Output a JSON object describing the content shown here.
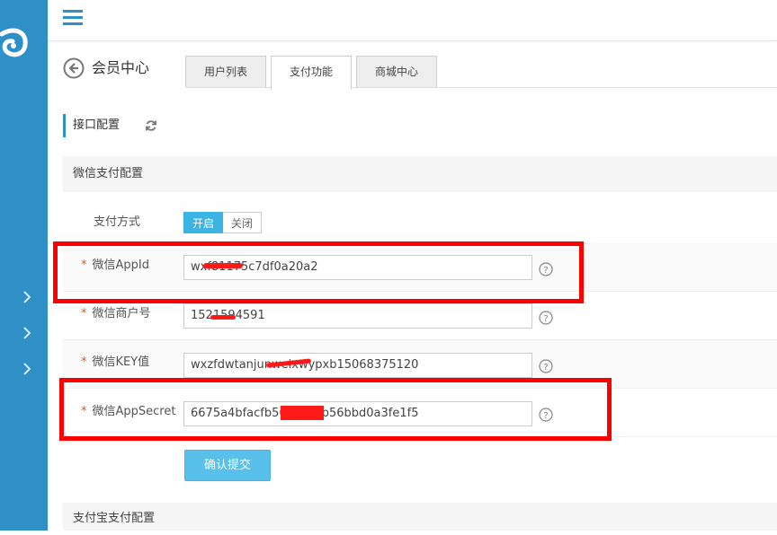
{
  "topbar": {
    "menu_icon": "hamburger-menu-icon"
  },
  "sidebar": {
    "logo_icon": "app-logo-icon",
    "arrows": [
      "chevron-right-icon",
      "chevron-right-icon",
      "chevron-right-icon"
    ]
  },
  "page": {
    "title": "会员中心",
    "back_icon": "back-arrow-circle-icon"
  },
  "tabs": [
    {
      "label": "用户列表",
      "active": false
    },
    {
      "label": "支付功能",
      "active": true
    },
    {
      "label": "商城中心",
      "active": false
    }
  ],
  "section": {
    "title": "接口配置",
    "refresh_icon": "refresh-icon"
  },
  "wechat": {
    "group_title": "微信支付配置",
    "pay_mode_label": "支付方式",
    "toggle_on": "开启",
    "toggle_off": "关闭",
    "fields": [
      {
        "label": "微信AppId",
        "value": "wxf81175c7df0a20a2"
      },
      {
        "label": "微信商户号",
        "value": "1521594591"
      },
      {
        "label": "微信KEY值",
        "value": "wxzfdwtanjunweixwypxb15068375120"
      },
      {
        "label": "微信AppSecret",
        "value": "6675a4bfacfb56cb1c7b56bbd0a3fe1f5"
      }
    ],
    "required_mark": "*",
    "help_icon": "question-circle-icon",
    "submit_label": "确认提交"
  },
  "alipay": {
    "group_title": "支付宝支付配置"
  },
  "colors": {
    "sidebar": "#2f8fc7",
    "accent": "#3bb4e3",
    "button": "#58c0ea",
    "annotation": "#ff0000",
    "required": "#e1541a"
  }
}
